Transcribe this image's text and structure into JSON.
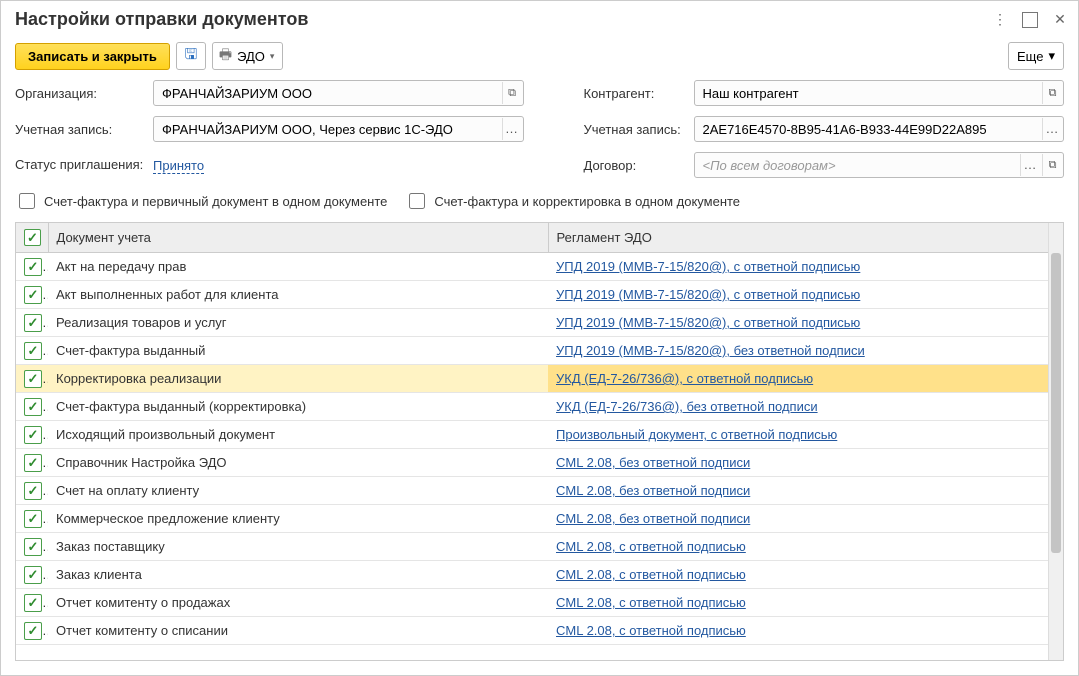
{
  "title": "Настройки отправки документов",
  "toolbar": {
    "save_close": "Записать и закрыть",
    "edo": "ЭДО",
    "more": "Еще"
  },
  "labels": {
    "org": "Организация:",
    "account": "Учетная запись:",
    "status": "Статус приглашения:",
    "contragent": "Контрагент:",
    "account2": "Учетная запись:",
    "contract": "Договор:"
  },
  "values": {
    "org": "ФРАНЧАЙЗАРИУМ ООО",
    "account": "ФРАНЧАЙЗАРИУМ ООО, Через сервис 1С-ЭДО",
    "status_link": "Принято",
    "contragent": "Наш контрагент",
    "account2": "2AE716E4570-8B95-41A6-B933-44E99D22A895",
    "contract_placeholder": "<По всем договорам>"
  },
  "checkboxes": {
    "cb1": "Счет-фактура и первичный документ в одном документе",
    "cb2": "Счет-фактура и корректировка в одном документе"
  },
  "table": {
    "col1": "Документ учета",
    "col2": "Регламент ЭДО",
    "rows": [
      {
        "doc": "Акт на передачу прав",
        "reg": "УПД 2019 (ММВ-7-15/820@), с ответной подписью",
        "sel": false
      },
      {
        "doc": "Акт выполненных работ для клиента",
        "reg": "УПД 2019 (ММВ-7-15/820@), с ответной подписью",
        "sel": false
      },
      {
        "doc": "Реализация товаров и услуг",
        "reg": "УПД 2019 (ММВ-7-15/820@), с ответной подписью",
        "sel": false
      },
      {
        "doc": "Счет-фактура выданный",
        "reg": "УПД 2019 (ММВ-7-15/820@), без ответной подписи",
        "sel": false
      },
      {
        "doc": "Корректировка реализации",
        "reg": "УКД (ЕД-7-26/736@), с ответной подписью",
        "sel": true
      },
      {
        "doc": "Счет-фактура выданный (корректировка)",
        "reg": "УКД (ЕД-7-26/736@), без ответной подписи",
        "sel": false
      },
      {
        "doc": "Исходящий произвольный документ",
        "reg": "Произвольный документ, с ответной подписью",
        "sel": false
      },
      {
        "doc": "Справочник Настройка ЭДО",
        "reg": "CML 2.08, без ответной подписи",
        "sel": false
      },
      {
        "doc": "Счет на оплату клиенту",
        "reg": "CML 2.08, без ответной подписи",
        "sel": false
      },
      {
        "doc": "Коммерческое предложение клиенту",
        "reg": "CML 2.08, без ответной подписи",
        "sel": false
      },
      {
        "doc": "Заказ поставщику",
        "reg": "CML 2.08, с ответной подписью",
        "sel": false
      },
      {
        "doc": "Заказ клиента",
        "reg": "CML 2.08, с ответной подписью",
        "sel": false
      },
      {
        "doc": "Отчет комитенту о продажах",
        "reg": "CML 2.08, с ответной подписью",
        "sel": false
      },
      {
        "doc": "Отчет комитенту о списании",
        "reg": "CML 2.08, с ответной подписью",
        "sel": false
      }
    ]
  }
}
